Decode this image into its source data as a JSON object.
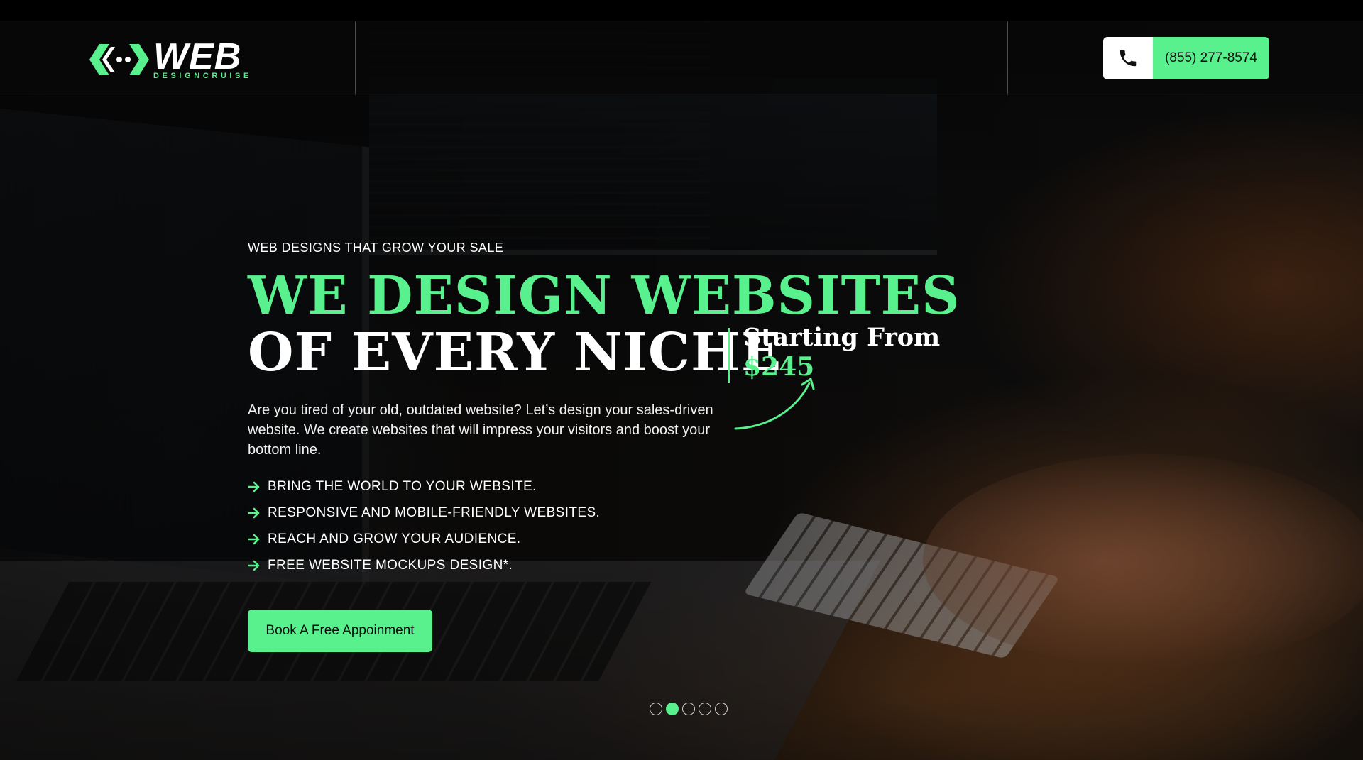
{
  "brand": {
    "name": "WEB",
    "tagline": "DESIGNCRUISE",
    "accent_color": "#58f18e"
  },
  "header": {
    "phone_icon": "phone-icon",
    "phone_number": "(855) 277-8574"
  },
  "hero": {
    "eyebrow": "WEB DESIGNS THAT GROW YOUR SALE",
    "headline_line1": "WE DESIGN WEBSITES",
    "headline_line2": "OF EVERY NICHE",
    "starting_label": "Starting From",
    "price": "$245",
    "intro": "Are you tired of your old, outdated website? Let’s design your sales-driven website. We create websites that will impress your visitors and boost your bottom line.",
    "features": [
      "BRING THE WORLD TO YOUR WEBSITE.",
      "RESPONSIVE AND MOBILE-FRIENDLY WEBSITES.",
      "REACH AND GROW YOUR AUDIENCE.",
      "FREE WEBSITE MOCKUPS DESIGN*."
    ],
    "cta_label": "Book A Free Appoinment"
  },
  "slider": {
    "total": 5,
    "active_index": 1
  }
}
